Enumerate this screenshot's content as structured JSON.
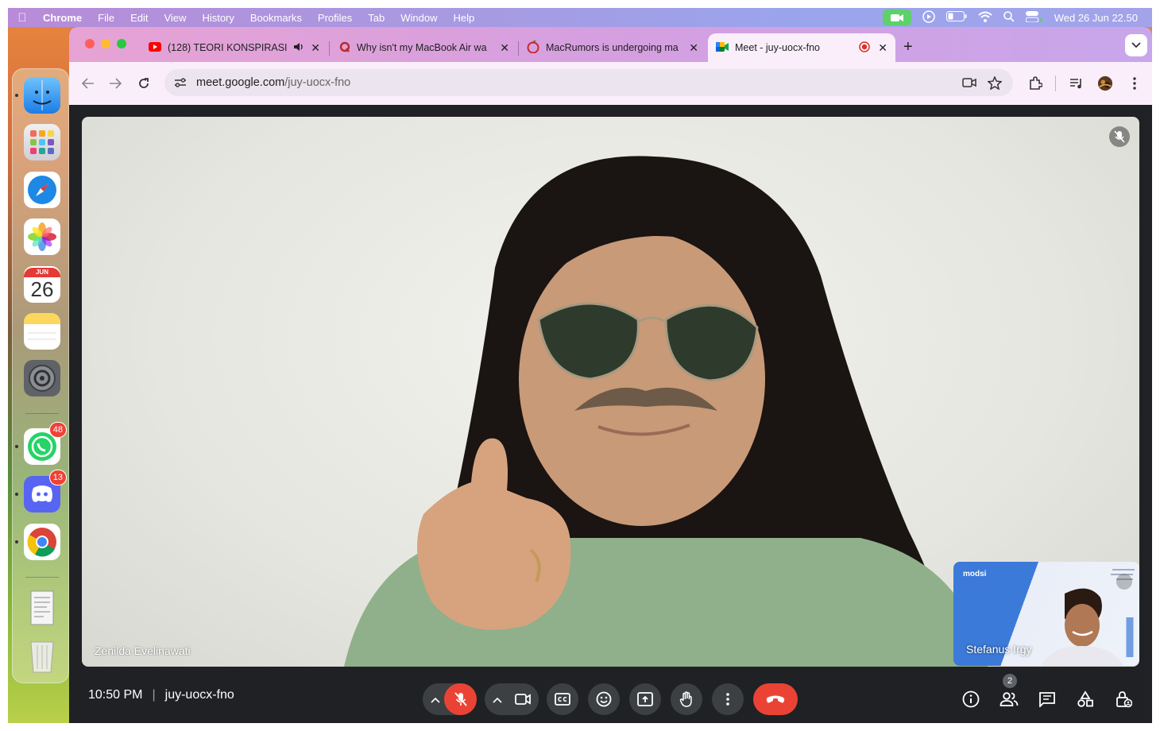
{
  "menubar": {
    "app_name": "Chrome",
    "menus": [
      "File",
      "Edit",
      "View",
      "History",
      "Bookmarks",
      "Profiles",
      "Tab",
      "Window",
      "Help"
    ],
    "clock": "Wed 26 Jun  22.50"
  },
  "dock": {
    "calendar_month": "JUN",
    "calendar_day": "26",
    "whatsapp_badge": "48",
    "discord_badge": "13"
  },
  "tabs": [
    {
      "title": "(128) TEORI KONSPIRASI"
    },
    {
      "title": "Why isn't my MacBook Air wa"
    },
    {
      "title": "MacRumors is undergoing ma"
    },
    {
      "title": "Meet - juy-uocx-fno"
    }
  ],
  "omnibox": {
    "url_host": "meet.google.com",
    "url_path": "/juy-uocx-fno"
  },
  "meet": {
    "main_participant": "Zenilda Evelinawati",
    "pip_participant": "Stefanus Irgy",
    "time": "10:50 PM",
    "meeting_code": "juy-uocx-fno",
    "people_count": "2"
  },
  "colors": {
    "end_call": "#ea4335",
    "mic_off": "#ea4335",
    "meet_bg": "#202124"
  }
}
